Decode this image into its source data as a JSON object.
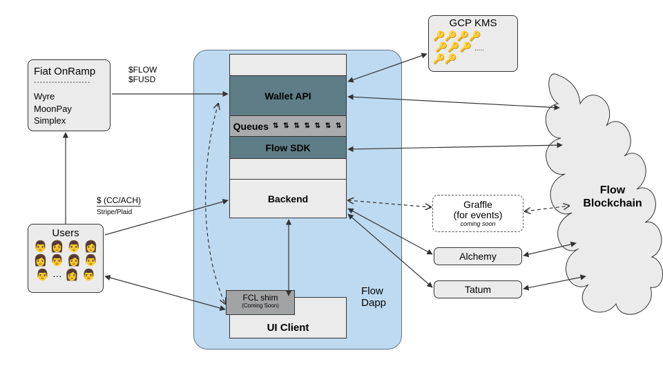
{
  "fiat": {
    "title": "Fiat OnRamp",
    "providers": [
      "Wyre",
      "MoonPay",
      "Simplex"
    ]
  },
  "users_title": "Users",
  "kms_title": "GCP KMS",
  "dapp_label": "Flow\nDapp",
  "stack": {
    "wallet": "Wallet API",
    "queues": "Queues",
    "sdk": "Flow SDK",
    "backend": "Backend"
  },
  "uiclient": "UI Client",
  "fcl": {
    "title": "FCL shim",
    "subtitle": "(Coming Soon)"
  },
  "graffle": {
    "title": "Graffle",
    "subtitle": "(for events)",
    "note": "coming soon"
  },
  "alchemy": "Alchemy",
  "tatum": "Tatum",
  "cloud_title": "Flow\nBlockchain",
  "edges": {
    "flow_tokens": "$FLOW\n$FUSD",
    "fiat_pay": "$ (CC/ACH)",
    "fiat_pay_sub": "Stripe/Plaid"
  }
}
